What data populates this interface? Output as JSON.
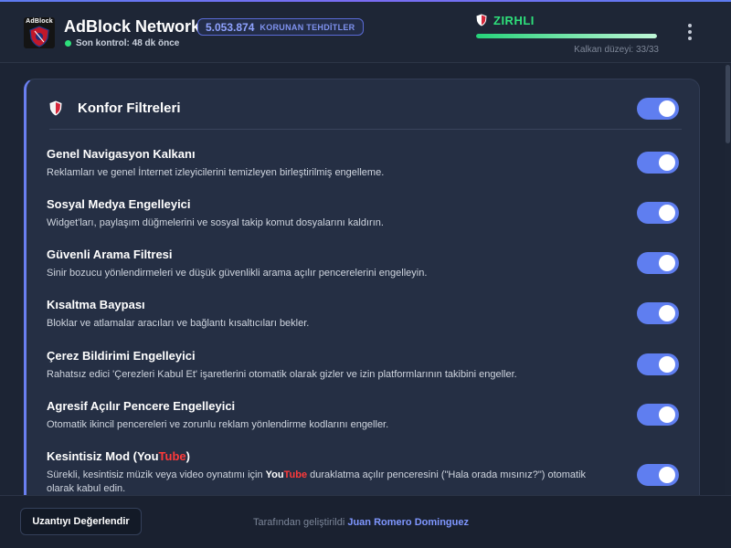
{
  "header": {
    "logo_text": "AdBlock",
    "app_title": "AdBlock Network",
    "blocked_count": "5.053.874",
    "blocked_label": "KORUNAN TEHDİTLER",
    "last_check": "Son kontrol: 48 dk önce",
    "armor_status": "ZIRHLI",
    "armor_color": "#2ee07b",
    "shield_level_text": "Kalkan düzeyi: 33/33",
    "shield_level_fraction": 1.0,
    "menu_icon": "kebab-menu-icon"
  },
  "card": {
    "title": "Konfor Filtreleri",
    "icon": "shield-icon",
    "master_enabled": true,
    "items": [
      {
        "title": "Genel Navigasyon Kalkanı",
        "desc": "Reklamları ve genel İnternet izleyicilerini temizleyen birleştirilmiş engelleme.",
        "enabled": true
      },
      {
        "title": "Sosyal Medya Engelleyici",
        "desc": "Widget'ları, paylaşım düğmelerini ve sosyal takip komut dosyalarını kaldırın.",
        "enabled": true
      },
      {
        "title": "Güvenli Arama Filtresi",
        "desc": "Sinir bozucu yönlendirmeleri ve düşük güvenlikli arama açılır pencerelerini engelleyin.",
        "enabled": true
      },
      {
        "title": "Kısaltma Baypası",
        "desc": "Bloklar ve atlamalar aracıları ve bağlantı kısaltıcıları bekler.",
        "enabled": true
      },
      {
        "title": "Çerez Bildirimi Engelleyici",
        "desc": "Rahatsız edici 'Çerezleri Kabul Et' işaretlerini otomatik olarak gizler ve izin platformlarının takibini engeller.",
        "enabled": true
      },
      {
        "title": "Agresif Açılır Pencere Engelleyici",
        "desc": "Otomatik ikincil pencereleri ve zorunlu reklam yönlendirme kodlarını engeller.",
        "enabled": true
      },
      {
        "title_prefix": "Kesintisiz Mod (You",
        "title_brand_red": "Tube",
        "title_suffix": ")",
        "desc_prefix": "Sürekli, kesintisiz müzik veya video oynatımı için ",
        "desc_brand_white": "You",
        "desc_brand_red": "Tube",
        "desc_suffix": " duraklatma açılır penceresini (\"Hala orada mısınız?\") otomatik olarak kabul edin.",
        "enabled": true
      }
    ]
  },
  "footer": {
    "rate_button": "Uzantıyı Değerlendir",
    "credit_prefix": "Tarafından geliştirildi",
    "credit_author": "Juan Romero Dominguez"
  },
  "colors": {
    "accent": "#5f7ef0",
    "youtube_red": "#ff3a3a",
    "background": "#1c2434"
  }
}
